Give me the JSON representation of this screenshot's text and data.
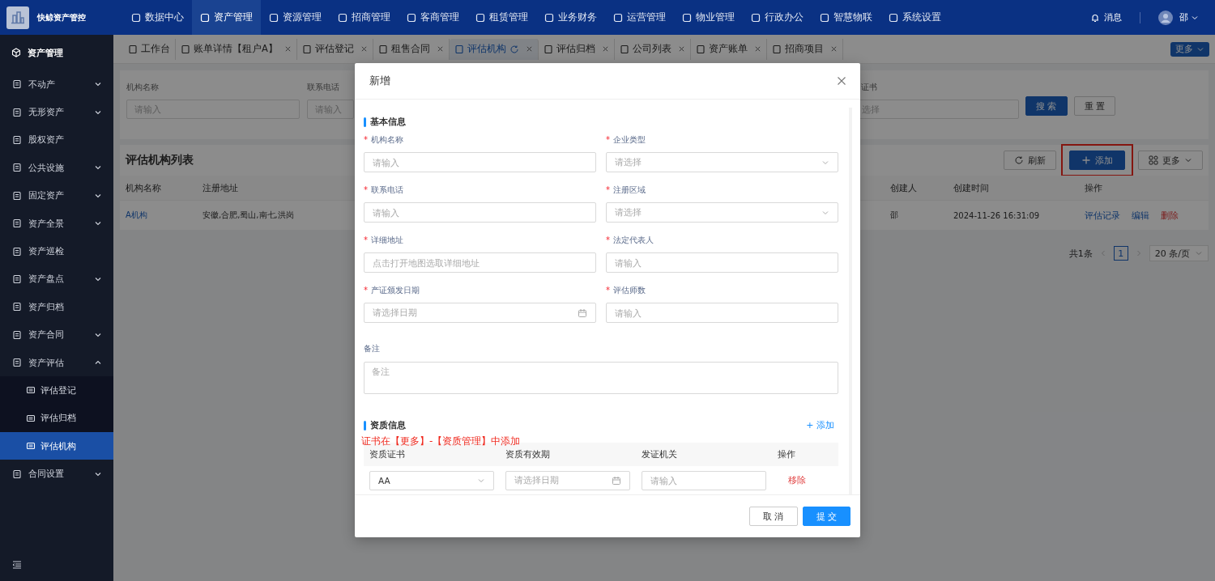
{
  "app": {
    "name": "快鲸资产管控"
  },
  "top_nav": [
    {
      "label": "数据中心",
      "selected": false
    },
    {
      "label": "资产管理",
      "selected": true
    },
    {
      "label": "资源管理",
      "selected": false
    },
    {
      "label": "招商管理",
      "selected": false
    },
    {
      "label": "客商管理",
      "selected": false
    },
    {
      "label": "租赁管理",
      "selected": false
    },
    {
      "label": "业务财务",
      "selected": false
    },
    {
      "label": "运营管理",
      "selected": false
    },
    {
      "label": "物业管理",
      "selected": false
    },
    {
      "label": "行政办公",
      "selected": false
    },
    {
      "label": "智慧物联",
      "selected": false
    },
    {
      "label": "系统设置",
      "selected": false
    }
  ],
  "user_menu": {
    "messages": "消息",
    "user": "邵"
  },
  "sidebar": {
    "title": "资产管理",
    "items": [
      {
        "label": "不动产",
        "expanded": false
      },
      {
        "label": "无形资产",
        "expanded": false
      },
      {
        "label": "股权资产"
      },
      {
        "label": "公共设施",
        "expanded": false
      },
      {
        "label": "固定资产",
        "expanded": false
      },
      {
        "label": "资产全景",
        "expanded": false
      },
      {
        "label": "资产巡检"
      },
      {
        "label": "资产盘点",
        "expanded": false
      },
      {
        "label": "资产归档"
      },
      {
        "label": "资产合同",
        "expanded": false
      },
      {
        "label": "资产评估",
        "expanded": true,
        "children": [
          {
            "label": "评估登记",
            "selected": false
          },
          {
            "label": "评估归档",
            "selected": false
          },
          {
            "label": "评估机构",
            "selected": true
          }
        ]
      },
      {
        "label": "合同设置",
        "expanded": false
      }
    ]
  },
  "tabs": [
    {
      "label": "工作台",
      "selected": false,
      "closable": false
    },
    {
      "label": "账单详情【租户A】",
      "selected": false,
      "closable": true
    },
    {
      "label": "评估登记",
      "selected": false,
      "closable": true
    },
    {
      "label": "租售合同",
      "selected": false,
      "closable": true
    },
    {
      "label": "评估机构",
      "selected": true,
      "closable": true
    },
    {
      "label": "评估归档",
      "selected": false,
      "closable": true
    },
    {
      "label": "公司列表",
      "selected": false,
      "closable": true
    },
    {
      "label": "资产账单",
      "selected": false,
      "closable": true
    },
    {
      "label": "招商项目",
      "selected": false,
      "closable": true
    }
  ],
  "tabs_more": "更多",
  "search_form": {
    "fields": [
      {
        "label": "机构名称",
        "placeholder": "请输入"
      },
      {
        "label": "联系电话",
        "placeholder": "请输入"
      },
      {
        "label": "证书",
        "placeholder": "选择"
      }
    ],
    "search": "搜 索",
    "reset": "重 置"
  },
  "list": {
    "title": "评估机构列表",
    "refresh": "刷新",
    "add": {
      "label": "添加",
      "highlighted": true
    },
    "more": "更多",
    "columns": [
      "机构名称",
      "注册地址",
      "创建人",
      "创建时间",
      "操作"
    ],
    "rows": [
      {
        "name": "A机构",
        "address": "安徽,合肥,蜀山,南七,洪岗",
        "creator": "邵",
        "created": "2024-11-26 16:31:09",
        "actions": [
          {
            "label": "评估记录",
            "kind": "link"
          },
          {
            "label": "编辑",
            "kind": "link"
          },
          {
            "label": "删除",
            "kind": "danger"
          }
        ]
      }
    ],
    "pagination": {
      "total": "共1条",
      "pages": [
        {
          "label": "1",
          "selected": true
        }
      ],
      "page_size": "20 条/页"
    }
  },
  "dialog": {
    "title": "新增",
    "basic_section": "基本信息",
    "required_mark": "*",
    "fields": [
      {
        "label": "机构名称",
        "required": true,
        "placeholder": "请输入",
        "kind": "input"
      },
      {
        "label": "企业类型",
        "required": true,
        "placeholder": "请选择",
        "kind": "select"
      },
      {
        "label": "联系电话",
        "required": true,
        "placeholder": "请输入",
        "kind": "input"
      },
      {
        "label": "注册区域",
        "required": true,
        "placeholder": "请选择",
        "kind": "select"
      },
      {
        "label": "详细地址",
        "required": true,
        "placeholder": "点击打开地图选取详细地址",
        "kind": "input"
      },
      {
        "label": "法定代表人",
        "required": true,
        "placeholder": "请输入",
        "kind": "input"
      },
      {
        "label": "产证颁发日期",
        "required": true,
        "placeholder": "请选择日期",
        "kind": "date"
      },
      {
        "label": "评估师数",
        "required": true,
        "placeholder": "请输入",
        "kind": "input"
      }
    ],
    "remarks": {
      "label": "备注",
      "placeholder": "备注"
    },
    "qual_section": "资质信息",
    "qual_add": "+ 添加",
    "note": "证书在【更多】-【资质管理】中添加",
    "qual_columns": [
      "资质证书",
      "资质有效期",
      "发证机关",
      "操作"
    ],
    "qual_rows": [
      {
        "certificate": "AA",
        "validity_placeholder": "请选择日期",
        "authority_placeholder": "请输入",
        "remove": "移除"
      }
    ],
    "cancel": "取 消",
    "submit": "提 交"
  }
}
